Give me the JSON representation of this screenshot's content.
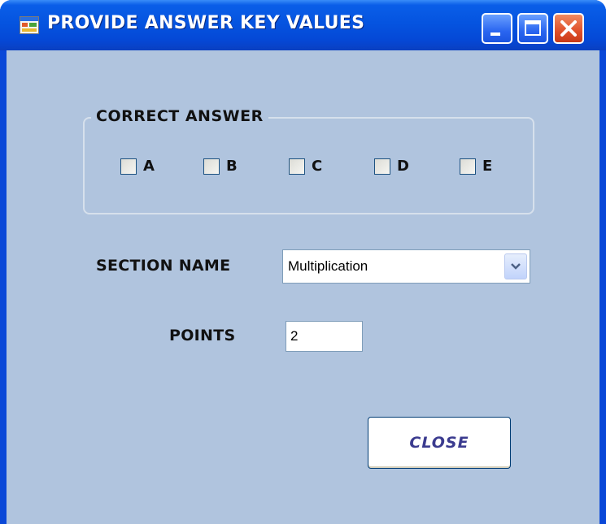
{
  "window": {
    "title": "PROVIDE ANSWER KEY VALUES",
    "app_icon": "form-icon",
    "controls": [
      "minimize-icon",
      "maximize-icon",
      "close-icon"
    ]
  },
  "correct_answer": {
    "legend": "CORRECT ANSWER",
    "options": [
      {
        "label": "A",
        "checked": false
      },
      {
        "label": "B",
        "checked": false
      },
      {
        "label": "C",
        "checked": false
      },
      {
        "label": "D",
        "checked": false
      },
      {
        "label": "E",
        "checked": false
      }
    ]
  },
  "section": {
    "label": "SECTION NAME",
    "value": "Multiplication",
    "dropdown_icon": "chevron-down-icon"
  },
  "points": {
    "label": "POINTS",
    "value": "2"
  },
  "close_button": {
    "label": "CLOSE"
  },
  "colors": {
    "client_background": "#b0c4de",
    "titlebar": "#0554e0",
    "close_label": "#3b3b8f"
  }
}
